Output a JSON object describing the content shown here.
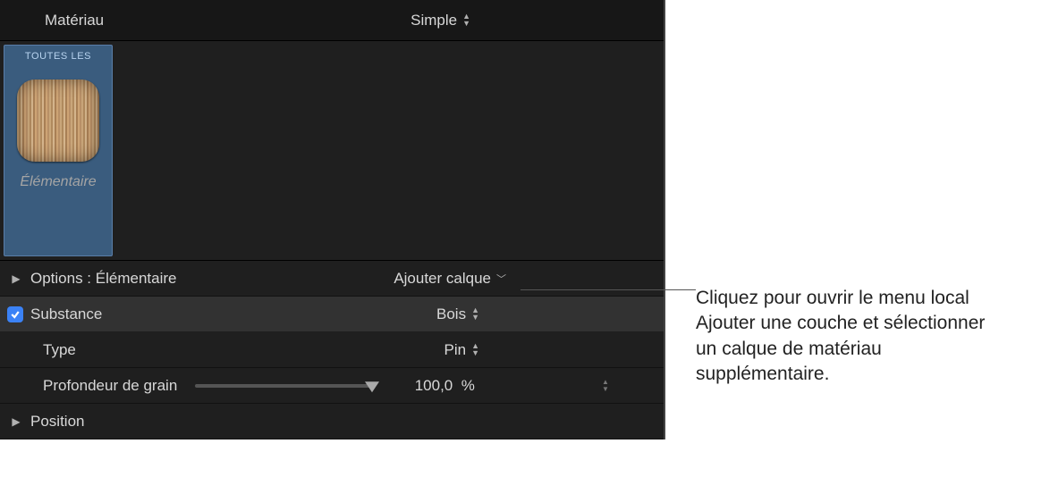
{
  "header": {
    "title": "Matériau",
    "mode": "Simple"
  },
  "thumbnail": {
    "all_label": "TOUTES LES",
    "name": "Élémentaire"
  },
  "options": {
    "label": "Options : Élémentaire",
    "add_layer": "Ajouter calque"
  },
  "properties": {
    "substance": {
      "label": "Substance",
      "value": "Bois",
      "checked": true
    },
    "type": {
      "label": "Type",
      "value": "Pin"
    },
    "grain_depth": {
      "label": "Profondeur de grain",
      "value": "100,0",
      "unit": "%"
    },
    "position": {
      "label": "Position"
    }
  },
  "callout": {
    "text": "Cliquez pour ouvrir le menu local Ajouter une couche et sélectionner un calque de matériau supplémentaire."
  }
}
